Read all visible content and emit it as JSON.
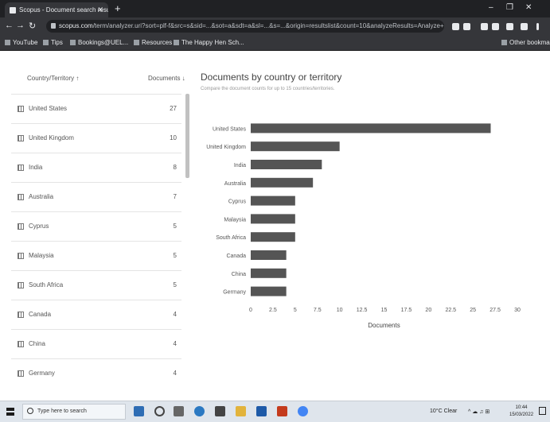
{
  "browser": {
    "tab_title": "Scopus - Document search results | ...",
    "url_host": "scopus.com",
    "url_rest": "/term/analyzer.uri?sort=plf-f&src=s&sid=...&sot=a&sdt=a&sl=...&s=...&origin=resultslist&count=10&analyzeResults=Analyze+results",
    "bookmarks": [
      "YouTube",
      "Tips",
      "Bookings@UEL...",
      "Resources",
      "The Happy Hen Sch...",
      "Other bookmarks"
    ]
  },
  "panel": {
    "col_country": "Country/Territory ↑",
    "col_documents": "Documents ↓"
  },
  "countries": [
    {
      "name": "United States",
      "count": "27"
    },
    {
      "name": "United Kingdom",
      "count": "10"
    },
    {
      "name": "India",
      "count": "8"
    },
    {
      "name": "Australia",
      "count": "7"
    },
    {
      "name": "Cyprus",
      "count": "5"
    },
    {
      "name": "Malaysia",
      "count": "5"
    },
    {
      "name": "South Africa",
      "count": "5"
    },
    {
      "name": "Canada",
      "count": "4"
    },
    {
      "name": "China",
      "count": "4"
    },
    {
      "name": "Germany",
      "count": "4"
    }
  ],
  "chart_title": "Documents by country or territory",
  "chart_subtitle": "Compare the document counts for up to 15 countries/territories.",
  "chart_data": {
    "type": "bar",
    "orientation": "horizontal",
    "categories": [
      "United States",
      "United Kingdom",
      "India",
      "Australia",
      "Cyprus",
      "Malaysia",
      "South Africa",
      "Canada",
      "China",
      "Germany"
    ],
    "values": [
      27,
      10,
      8,
      7,
      5,
      5,
      5,
      4,
      4,
      4
    ],
    "xlabel": "Documents",
    "ylabel": "",
    "xlim": [
      0,
      30
    ],
    "xticks": [
      "0",
      "2.5",
      "5",
      "7.5",
      "10",
      "12.5",
      "15",
      "17.5",
      "20",
      "22.5",
      "25",
      "27.5",
      "30"
    ],
    "bar_color": "#555555",
    "grid": false
  },
  "taskbar": {
    "search_placeholder": "Type here to search",
    "weather": "10°C Clear",
    "time": "10:44",
    "date": "15/03/2022"
  }
}
